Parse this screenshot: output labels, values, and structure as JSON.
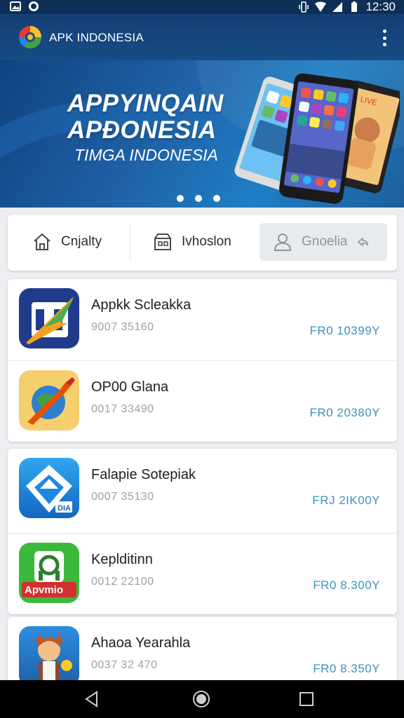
{
  "status_bar": {
    "time": "12:30",
    "icons": [
      "image-icon",
      "whatsapp-icon",
      "vibrate-icon",
      "wifi-icon",
      "signal-icon",
      "battery-icon"
    ]
  },
  "header": {
    "title": "APK INDONESIA",
    "menu_icon": "kebab-menu-icon"
  },
  "banner": {
    "line1": "APPYINQAIN",
    "line2": "APÐONESIA",
    "line3": "TIMGA INDONESIA",
    "slide_count": 3,
    "active_slide": 1
  },
  "tabs": [
    {
      "label": "Cnjalty",
      "icon": "home-icon"
    },
    {
      "label": "Ivhoslon",
      "icon": "store-icon"
    },
    {
      "label": "Gnoelia",
      "icon": "user-icon",
      "selected": true
    }
  ],
  "apps": [
    {
      "name": "Appkk Scleakka",
      "meta": "9007 35160",
      "price": "FR0 10399Y",
      "icon": "bolt-app-icon"
    },
    {
      "name": "OP00 Glana",
      "meta": "0017 33490",
      "price": "FR0 20380Y",
      "icon": "globe-brush-app-icon"
    },
    {
      "name": "Falapie Sotepiak",
      "meta": "0007 35130",
      "price": "FRJ 2IK00Y",
      "icon": "shield-app-icon"
    },
    {
      "name": "Keplditinn",
      "meta": "0012 22100",
      "price": "FR0 8.300Y",
      "icon": "green-box-app-icon"
    },
    {
      "name": "Ahaoa Yearahla",
      "meta": "0037 32 470",
      "price": "FR0 8.350Y",
      "icon": "character-app-icon"
    }
  ],
  "app_badge_text": "Apvmio",
  "app_badge_small": "DIA",
  "phones_screen_label": "LIVE",
  "colors": {
    "header": "#123f74",
    "banner": "#1f63a9",
    "price": "#3b93b8",
    "selected_tab": "#e7ebee"
  },
  "nav": {
    "back": "back-triangle-icon",
    "home": "home-circle-icon",
    "recents": "recents-square-icon"
  }
}
